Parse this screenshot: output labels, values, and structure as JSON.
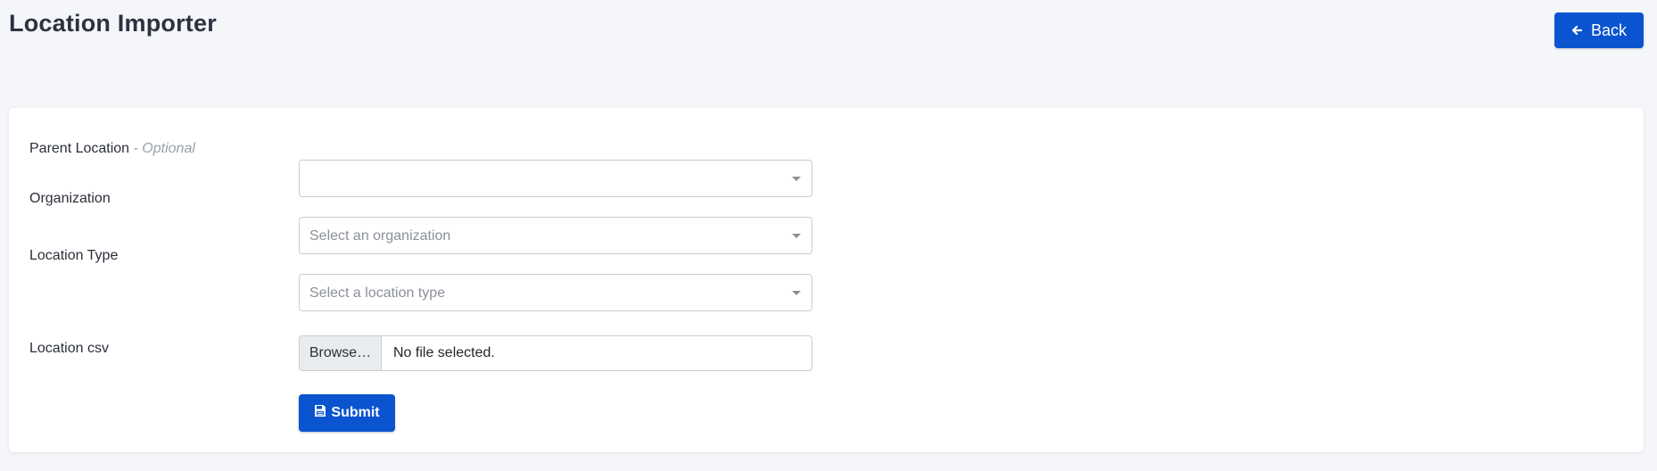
{
  "header": {
    "title": "Location Importer",
    "back_label": "Back"
  },
  "form": {
    "parent_location": {
      "label": "Parent Location",
      "optional_note": "- Optional",
      "value": ""
    },
    "organization": {
      "label": "Organization",
      "placeholder": "Select an organization"
    },
    "location_type": {
      "label": "Location Type",
      "placeholder": "Select a location type"
    },
    "location_csv": {
      "label": "Location csv",
      "browse_label": "Browse…",
      "file_status": "No file selected."
    },
    "submit_label": "Submit"
  },
  "icons": {
    "back": "arrow-left-icon",
    "submit": "save-icon",
    "dropdown": "caret-down-icon"
  },
  "colors": {
    "primary": "#0a54cf",
    "background": "#f5f6fa",
    "card": "#ffffff"
  }
}
